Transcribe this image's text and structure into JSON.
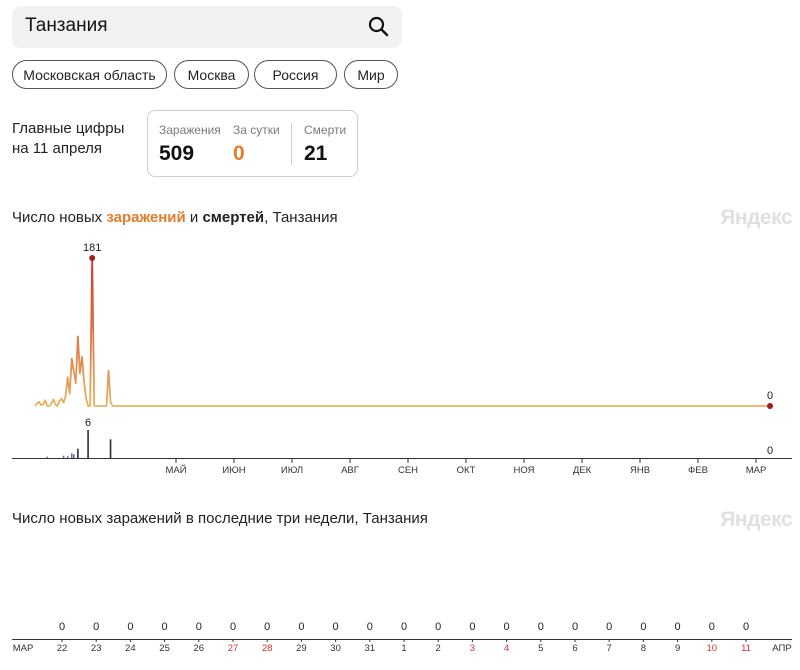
{
  "search": {
    "query": "Танзания"
  },
  "regions": [
    "Московская область",
    "Москва",
    "Россия",
    "Мир"
  ],
  "summary": {
    "label_line1": "Главные цифры",
    "label_line2": "на 11 апреля",
    "infections_label": "Заражения",
    "infections_value": "509",
    "daily_label": "За сутки",
    "daily_value": "0",
    "deaths_label": "Смерти",
    "deaths_value": "21"
  },
  "chart1": {
    "title_prefix": "Число новых ",
    "title_infections": "заражений",
    "title_and": " и ",
    "title_deaths": "смертей",
    "title_suffix": ", Танзания",
    "logo": "Яндекс"
  },
  "chart2": {
    "title": "Число новых заражений в последние три недели, Танзания",
    "logo": "Яндекс"
  },
  "colors": {
    "accent": "#e37c2b",
    "infection_line": "#e9b15f",
    "peak_line": "#d2342b",
    "death_bar": "#2d2d3d",
    "holiday": "#d2342b"
  },
  "chart_data": [
    {
      "type": "line",
      "series": [
        {
          "name": "заражений",
          "x": [
            0,
            1,
            2,
            3,
            4,
            5,
            6,
            7,
            8,
            9,
            10,
            11,
            12,
            13,
            14,
            15,
            16,
            17,
            18,
            19,
            20,
            21,
            22,
            23,
            24,
            25,
            26,
            27,
            28,
            29,
            30,
            31,
            32,
            33,
            34,
            35,
            36,
            37,
            38,
            39,
            40,
            360
          ],
          "values": [
            0,
            3,
            5,
            1,
            2,
            7,
            0,
            0,
            3,
            8,
            2,
            0,
            6,
            9,
            4,
            12,
            35,
            15,
            58,
            42,
            28,
            85,
            40,
            60,
            30,
            10,
            0,
            0,
            181,
            0,
            0,
            0,
            0,
            0,
            0,
            0,
            43,
            5,
            0,
            0,
            0,
            0
          ]
        },
        {
          "name": "смертей",
          "type": "bar",
          "x": [
            6,
            14,
            16,
            18,
            19,
            21,
            26,
            37
          ],
          "values": [
            0.3,
            0.5,
            0.4,
            1,
            0.8,
            2,
            6,
            4
          ]
        }
      ],
      "labels": {
        "peak_infections": "181",
        "peak_deaths": "6",
        "last_infections": "0",
        "last_deaths": "0"
      },
      "months": [
        "МАЙ",
        "ИЮН",
        "ИЮЛ",
        "АВГ",
        "СЕН",
        "ОКТ",
        "НОЯ",
        "ДЕК",
        "ЯНВ",
        "ФЕВ",
        "МАР"
      ]
    },
    {
      "type": "bar",
      "series": [
        {
          "values": [
            0,
            0,
            0,
            0,
            0,
            0,
            0,
            0,
            0,
            0,
            0,
            0,
            0,
            0,
            0,
            0,
            0,
            0,
            0,
            0,
            0
          ]
        }
      ],
      "start_label": "МАР",
      "end_label": "АПР",
      "categories": [
        "22",
        "23",
        "24",
        "25",
        "26",
        "27",
        "28",
        "29",
        "30",
        "31",
        "1",
        "2",
        "3",
        "4",
        "5",
        "6",
        "7",
        "8",
        "9",
        "10",
        "11"
      ],
      "holiday_indices": [
        5,
        6,
        12,
        13,
        19,
        20
      ]
    }
  ]
}
